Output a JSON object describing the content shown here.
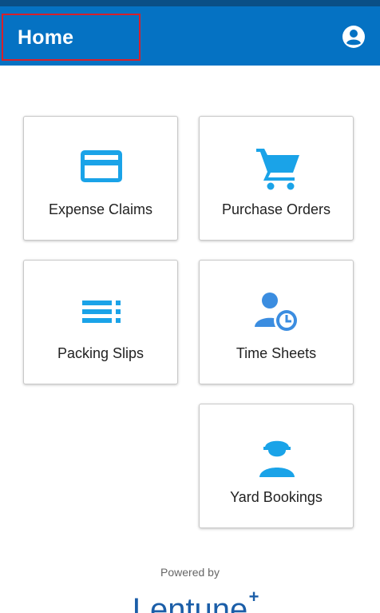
{
  "app_bar": {
    "title": "Home",
    "account_icon": "account-circle-icon"
  },
  "tiles": [
    {
      "label": "Expense Claims",
      "icon": "credit-card-icon"
    },
    {
      "label": "Purchase Orders",
      "icon": "shopping-cart-icon"
    },
    {
      "label": "Packing Slips",
      "icon": "list-icon"
    },
    {
      "label": "Time Sheets",
      "icon": "person-clock-icon"
    },
    {
      "label": "Yard Bookings",
      "icon": "worker-hardhat-icon"
    }
  ],
  "footer": {
    "powered_by": "Powered by",
    "brand_logo_text": "Lentune+"
  },
  "colors": {
    "app_bar": "#0572c3",
    "status_bar": "#0a4f86",
    "icon_primary": "#1aa3e8",
    "icon_secondary": "#3b8de0",
    "brand": "#1b5ea8"
  }
}
